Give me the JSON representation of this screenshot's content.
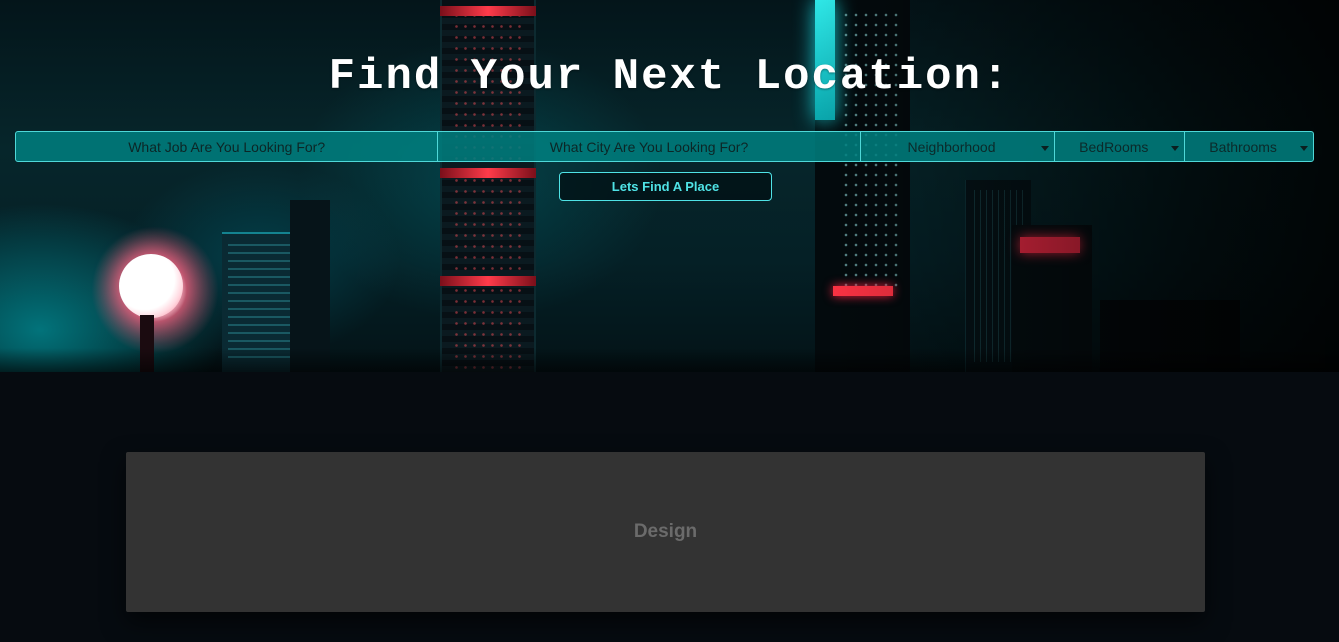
{
  "hero": {
    "title": "Find Your Next Location:"
  },
  "search": {
    "job_placeholder": "What Job Are You Looking For?",
    "city_placeholder": "What City Are You Looking For?",
    "neighborhood_label": "Neighborhood",
    "bedrooms_label": "BedRooms",
    "bathrooms_label": "Bathrooms",
    "submit_label": "Lets Find A Place"
  },
  "section": {
    "card_title": "Design"
  },
  "colors": {
    "accent": "#4fe3e6",
    "search_bg": "#008080",
    "card_bg": "#333333",
    "page_bg": "#060b10"
  }
}
